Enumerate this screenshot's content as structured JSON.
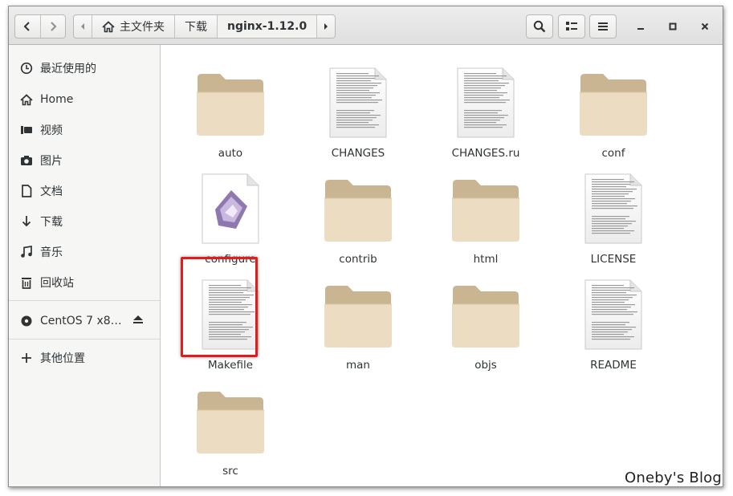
{
  "header": {
    "breadcrumbs": [
      "主文件夹",
      "下载",
      "nginx-1.12.0"
    ],
    "active_breadcrumb": "nginx-1.12.0"
  },
  "sidebar": {
    "items": [
      {
        "label": "最近使用的",
        "icon": "clock-icon"
      },
      {
        "label": "Home",
        "icon": "home-icon"
      },
      {
        "label": "视频",
        "icon": "video-icon"
      },
      {
        "label": "图片",
        "icon": "camera-icon"
      },
      {
        "label": "文档",
        "icon": "document-icon"
      },
      {
        "label": "下载",
        "icon": "download-icon"
      },
      {
        "label": "音乐",
        "icon": "music-icon"
      },
      {
        "label": "回收站",
        "icon": "trash-icon"
      }
    ],
    "devices": [
      {
        "label": "CentOS 7 x8…",
        "icon": "disc-icon",
        "eject_icon": "eject-icon"
      }
    ],
    "other": {
      "label": "其他位置",
      "icon": "plus-icon"
    }
  },
  "files": [
    {
      "name": "auto",
      "type": "folder"
    },
    {
      "name": "CHANGES",
      "type": "text"
    },
    {
      "name": "CHANGES.ru",
      "type": "text"
    },
    {
      "name": "conf",
      "type": "folder"
    },
    {
      "name": "configure",
      "type": "script"
    },
    {
      "name": "contrib",
      "type": "folder"
    },
    {
      "name": "html",
      "type": "folder"
    },
    {
      "name": "LICENSE",
      "type": "text"
    },
    {
      "name": "Makefile",
      "type": "text",
      "highlighted": true
    },
    {
      "name": "man",
      "type": "folder"
    },
    {
      "name": "objs",
      "type": "folder"
    },
    {
      "name": "README",
      "type": "text"
    },
    {
      "name": "src",
      "type": "folder"
    }
  ],
  "colors": {
    "folder_back": "#c9b591",
    "folder_front": "#ecdcc2",
    "highlight": "#e21b1b"
  },
  "watermark": "Oneby's Blog"
}
